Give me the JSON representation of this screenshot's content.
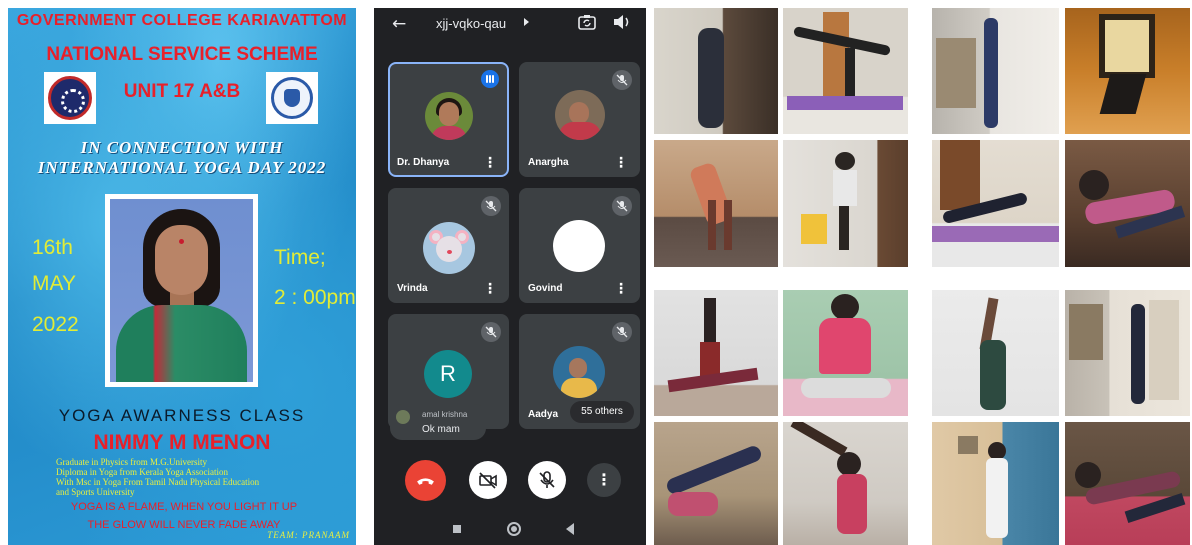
{
  "poster": {
    "college": "GOVERNMENT COLLEGE KARIAVATTOM",
    "scheme": "NATIONAL SERVICE SCHEME",
    "unit": "UNIT 17 A&B",
    "connection_line1": "IN CONNECTION WITH",
    "connection_line2": "INTERNATIONAL YOGA DAY 2022",
    "date_day": "16th",
    "date_month": "MAY",
    "date_year": "2022",
    "time_label": "Time;",
    "time_value": "2 : 00pm",
    "event_title": "YOGA AWARNESS CLASS",
    "speaker": "NIMMY M MENON",
    "qualifications": [
      "Graduate in Physics from M.G.University",
      "Diploma in Yoga from Kerala Yoga Association",
      "With Msc in Yoga From Tamil Nadu Physical Education",
      "and Sports University"
    ],
    "quote_line1": "YOGA IS A FLAME, WHEN YOU LIGHT IT UP",
    "quote_line2": "THE GLOW WILL NEVER FADE AWAY",
    "team": "TEAM: PRANAAM",
    "colors": {
      "title_red": "#e8202a",
      "accent_yellow": "#e2ec36",
      "background_blue": "#2c9ad6"
    }
  },
  "meet": {
    "meeting_code": "xjj-vqko-qau",
    "icons": {
      "back": "arrow-left-icon",
      "switch_camera": "switch-camera-icon",
      "audio": "speaker-icon",
      "muted": "mic-off-icon",
      "more": "more-vert-icon",
      "end_call": "call-end-icon",
      "camera_off": "videocam-off-icon",
      "mic_off": "mic-off-icon"
    },
    "participants": [
      {
        "name": "Dr. Dhanya",
        "state": "speaking"
      },
      {
        "name": "Anargha",
        "state": "muted"
      },
      {
        "name": "Vrinda",
        "state": "muted"
      },
      {
        "name": "Govind",
        "state": "muted"
      },
      {
        "name": "",
        "initial": "R",
        "state": "muted"
      },
      {
        "name": "Aadya",
        "state": "muted"
      }
    ],
    "others_count": "55 others",
    "chat": {
      "user": "amal krishna",
      "message": "Ok mam"
    },
    "more_glyph": "⋮",
    "colors": {
      "background": "#202124",
      "tile": "#3c4043",
      "end_call": "#ea4335",
      "speaking_indicator": "#1a73e8",
      "initial_avatar": "#128a8d"
    }
  },
  "collage": {
    "photo_count": 16,
    "subject": "participants practicing yoga poses at home"
  }
}
